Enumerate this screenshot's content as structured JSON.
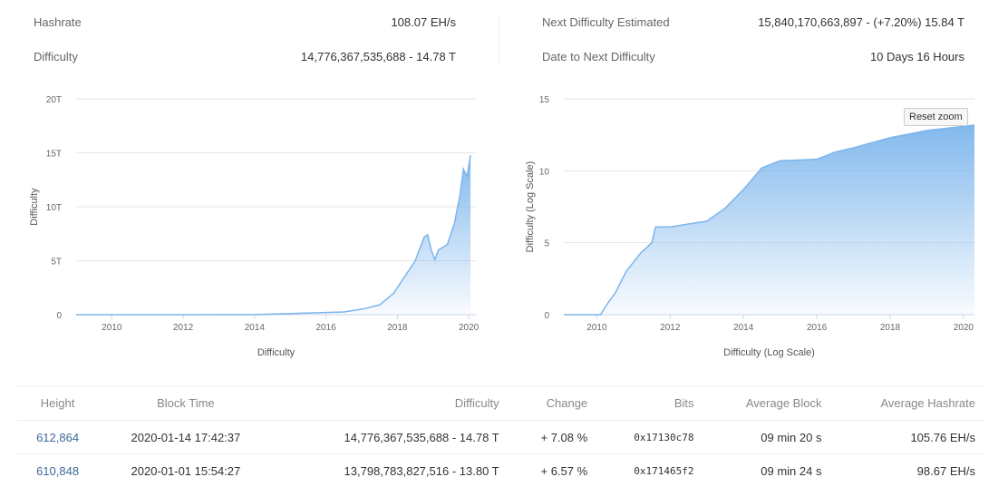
{
  "stats": {
    "hashrate_label": "Hashrate",
    "hashrate_value": "108.07 EH/s",
    "difficulty_label": "Difficulty",
    "difficulty_value": "14,776,367,535,688 - 14.78 T",
    "next_label": "Next Difficulty Estimated",
    "next_value": "15,840,170,663,897 - (+7.20%) 15.84 T",
    "date_label": "Date to Next Difficulty",
    "date_value": "10 Days 16 Hours"
  },
  "reset_zoom": "Reset zoom",
  "chart_data": [
    {
      "type": "area",
      "xlabel": "Difficulty",
      "ylabel": "Difficulty",
      "xlim": [
        2009,
        2020.2
      ],
      "ylim": [
        0,
        20
      ],
      "xticks": [
        "2010",
        "2012",
        "2014",
        "2016",
        "2018",
        "2020"
      ],
      "yticks": [
        "0",
        "5T",
        "10T",
        "15T",
        "20T"
      ],
      "grid": true,
      "color": "#7cb5ec",
      "x": [
        2009,
        2010,
        2012,
        2014,
        2016,
        2016.5,
        2017,
        2017.5,
        2017.9,
        2018.2,
        2018.5,
        2018.75,
        2018.85,
        2018.95,
        2019.05,
        2019.15,
        2019.4,
        2019.6,
        2019.75,
        2019.85,
        2019.95,
        2020.0,
        2020.05
      ],
      "y": [
        0,
        0,
        0,
        0.01,
        0.2,
        0.25,
        0.5,
        0.9,
        2,
        3.5,
        5,
        7.2,
        7.4,
        6,
        5.1,
        6,
        6.5,
        8.5,
        11,
        13.5,
        12.8,
        13.8,
        14.78
      ]
    },
    {
      "type": "area",
      "xlabel": "Difficulty (Log Scale)",
      "ylabel": "Difficulty (Log Scale)",
      "xlim": [
        2009.1,
        2020.3
      ],
      "ylim": [
        0,
        15
      ],
      "xticks": [
        "2010",
        "2012",
        "2014",
        "2016",
        "2018",
        "2020"
      ],
      "yticks": [
        "0",
        "5",
        "10",
        "15"
      ],
      "grid": true,
      "color": "#7cb5ec",
      "x": [
        2009.1,
        2010.1,
        2010.3,
        2010.5,
        2010.8,
        2011.2,
        2011.5,
        2011.6,
        2012,
        2012.5,
        2013,
        2013.5,
        2014,
        2014.5,
        2015,
        2016,
        2016.5,
        2017,
        2018,
        2019,
        2020.3
      ],
      "y": [
        0,
        0,
        0.8,
        1.5,
        3,
        4.3,
        5,
        6.1,
        6.1,
        6.3,
        6.5,
        7.4,
        8.7,
        10.2,
        10.7,
        10.8,
        11.3,
        11.6,
        12.3,
        12.8,
        13.17
      ]
    }
  ],
  "table": {
    "headers": [
      "Height",
      "Block Time",
      "Difficulty",
      "Change",
      "Bits",
      "Average Block",
      "Average Hashrate"
    ],
    "rows": [
      [
        "612,864",
        "2020-01-14 17:42:37",
        "14,776,367,535,688 - 14.78 T",
        "+ 7.08 %",
        "0x17130c78",
        "09 min 20 s",
        "105.76 EH/s"
      ],
      [
        "610,848",
        "2020-01-01 15:54:27",
        "13,798,783,827,516 - 13.80 T",
        "+ 6.57 %",
        "0x171465f2",
        "09 min 24 s",
        "98.67 EH/s"
      ]
    ]
  }
}
